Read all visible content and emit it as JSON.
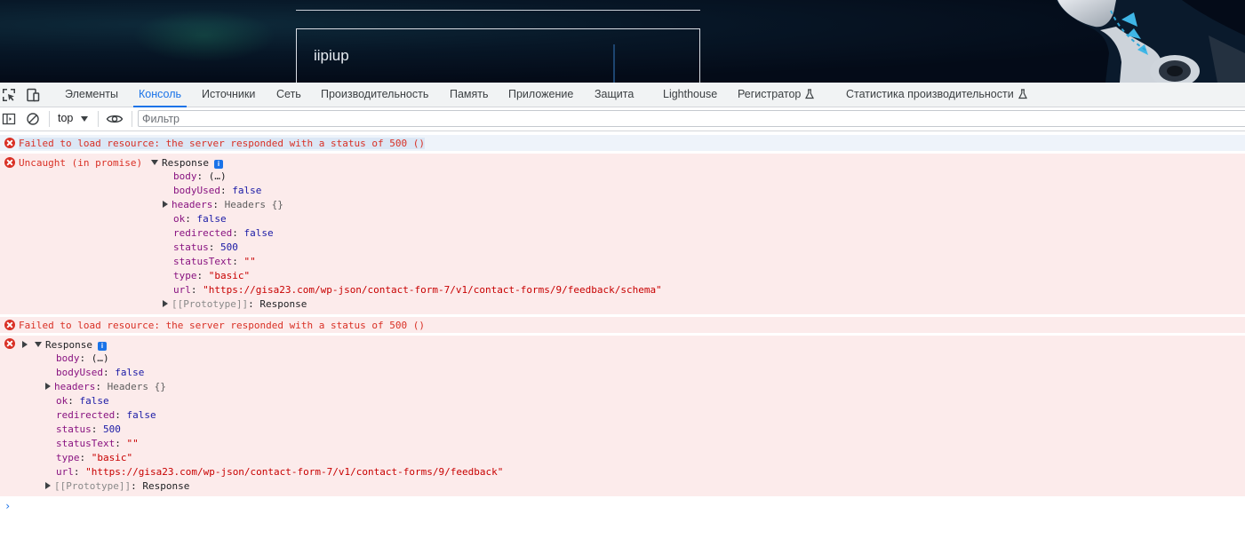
{
  "page_preview": {
    "box_text": "iipiup"
  },
  "devtools": {
    "tabs": [
      {
        "label": "Элементы",
        "active": false
      },
      {
        "label": "Консоль",
        "active": true
      },
      {
        "label": "Источники",
        "active": false
      },
      {
        "label": "Сеть",
        "active": false
      },
      {
        "label": "Производительность",
        "active": false
      },
      {
        "label": "Память",
        "active": false
      },
      {
        "label": "Приложение",
        "active": false
      },
      {
        "label": "Защита",
        "active": false
      },
      {
        "label": "Lighthouse",
        "active": false
      },
      {
        "label": "Регистратор",
        "active": false,
        "experimental": true
      },
      {
        "label": "Статистика производительности",
        "active": false,
        "experimental": true
      }
    ],
    "accent_color": "#1a73e8"
  },
  "console_toolbar": {
    "context": "top",
    "filter_placeholder": "Фильтр"
  },
  "messages": [
    {
      "text": "Failed to load resource: the server responded with a status of 500 ()"
    },
    {
      "prefix": "Uncaught (in promise)",
      "object": "Response",
      "props": {
        "body_k": "body",
        "body_v": "(…)",
        "bodyUsed_k": "bodyUsed",
        "bodyUsed_v": "false",
        "headers_k": "headers",
        "headers_v": "Headers {}",
        "ok_k": "ok",
        "ok_v": "false",
        "redirected_k": "redirected",
        "redirected_v": "false",
        "status_k": "status",
        "status_v": "500",
        "statusText_k": "statusText",
        "statusText_v": "\"\"",
        "type_k": "type",
        "type_v": "\"basic\"",
        "url_k": "url",
        "url_v": "\"https://gisa23.com/wp-json/contact-form-7/v1/contact-forms/9/feedback/schema\"",
        "proto_k": "[[Prototype]]",
        "proto_v": "Response"
      }
    },
    {
      "text": "Failed to load resource: the server responded with a status of 500 ()"
    },
    {
      "object": "Response",
      "props": {
        "body_k": "body",
        "body_v": "(…)",
        "bodyUsed_k": "bodyUsed",
        "bodyUsed_v": "false",
        "headers_k": "headers",
        "headers_v": "Headers {}",
        "ok_k": "ok",
        "ok_v": "false",
        "redirected_k": "redirected",
        "redirected_v": "false",
        "status_k": "status",
        "status_v": "500",
        "statusText_k": "statusText",
        "statusText_v": "\"\"",
        "type_k": "type",
        "type_v": "\"basic\"",
        "url_k": "url",
        "url_v": "\"https://gisa23.com/wp-json/contact-form-7/v1/contact-forms/9/feedback\"",
        "proto_k": "[[Prototype]]",
        "proto_v": "Response"
      }
    }
  ],
  "prompt_symbol": "›",
  "colors": {
    "error_text": "#d93025",
    "error_bg": "#fcebeb",
    "key": "#881280",
    "string": "#c80000",
    "keyword": "#1a1aa6"
  }
}
